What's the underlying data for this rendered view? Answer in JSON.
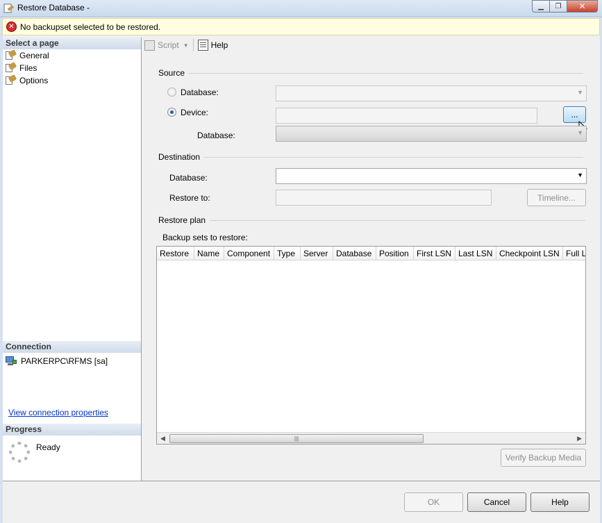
{
  "window": {
    "title": "Restore Database -"
  },
  "error": {
    "message": "No backupset selected to be restored."
  },
  "left_panel": {
    "select_page_header": "Select a page",
    "pages": [
      {
        "label": "General"
      },
      {
        "label": "Files"
      },
      {
        "label": "Options"
      }
    ],
    "connection_header": "Connection",
    "connection_value": "PARKERPC\\RFMS [sa]",
    "connection_link": "View connection properties",
    "progress_header": "Progress",
    "progress_status": "Ready"
  },
  "toolbar": {
    "script_label": "Script",
    "help_label": "Help"
  },
  "source": {
    "header": "Source",
    "database_radio_label": "Database:",
    "device_radio_label": "Device:",
    "device_selected": true,
    "browse_button_label": "...",
    "device_database_label": "Database:"
  },
  "destination": {
    "header": "Destination",
    "database_label": "Database:",
    "restore_to_label": "Restore to:",
    "timeline_button_label": "Timeline..."
  },
  "restore_plan": {
    "header": "Restore plan",
    "backup_sets_label": "Backup sets to restore:",
    "columns": [
      "Restore",
      "Name",
      "Component",
      "Type",
      "Server",
      "Database",
      "Position",
      "First LSN",
      "Last LSN",
      "Checkpoint LSN",
      "Full LSN"
    ],
    "verify_button_label": "Verify Backup Media"
  },
  "buttons": {
    "ok_label": "OK",
    "cancel_label": "Cancel",
    "help_label": "Help"
  }
}
